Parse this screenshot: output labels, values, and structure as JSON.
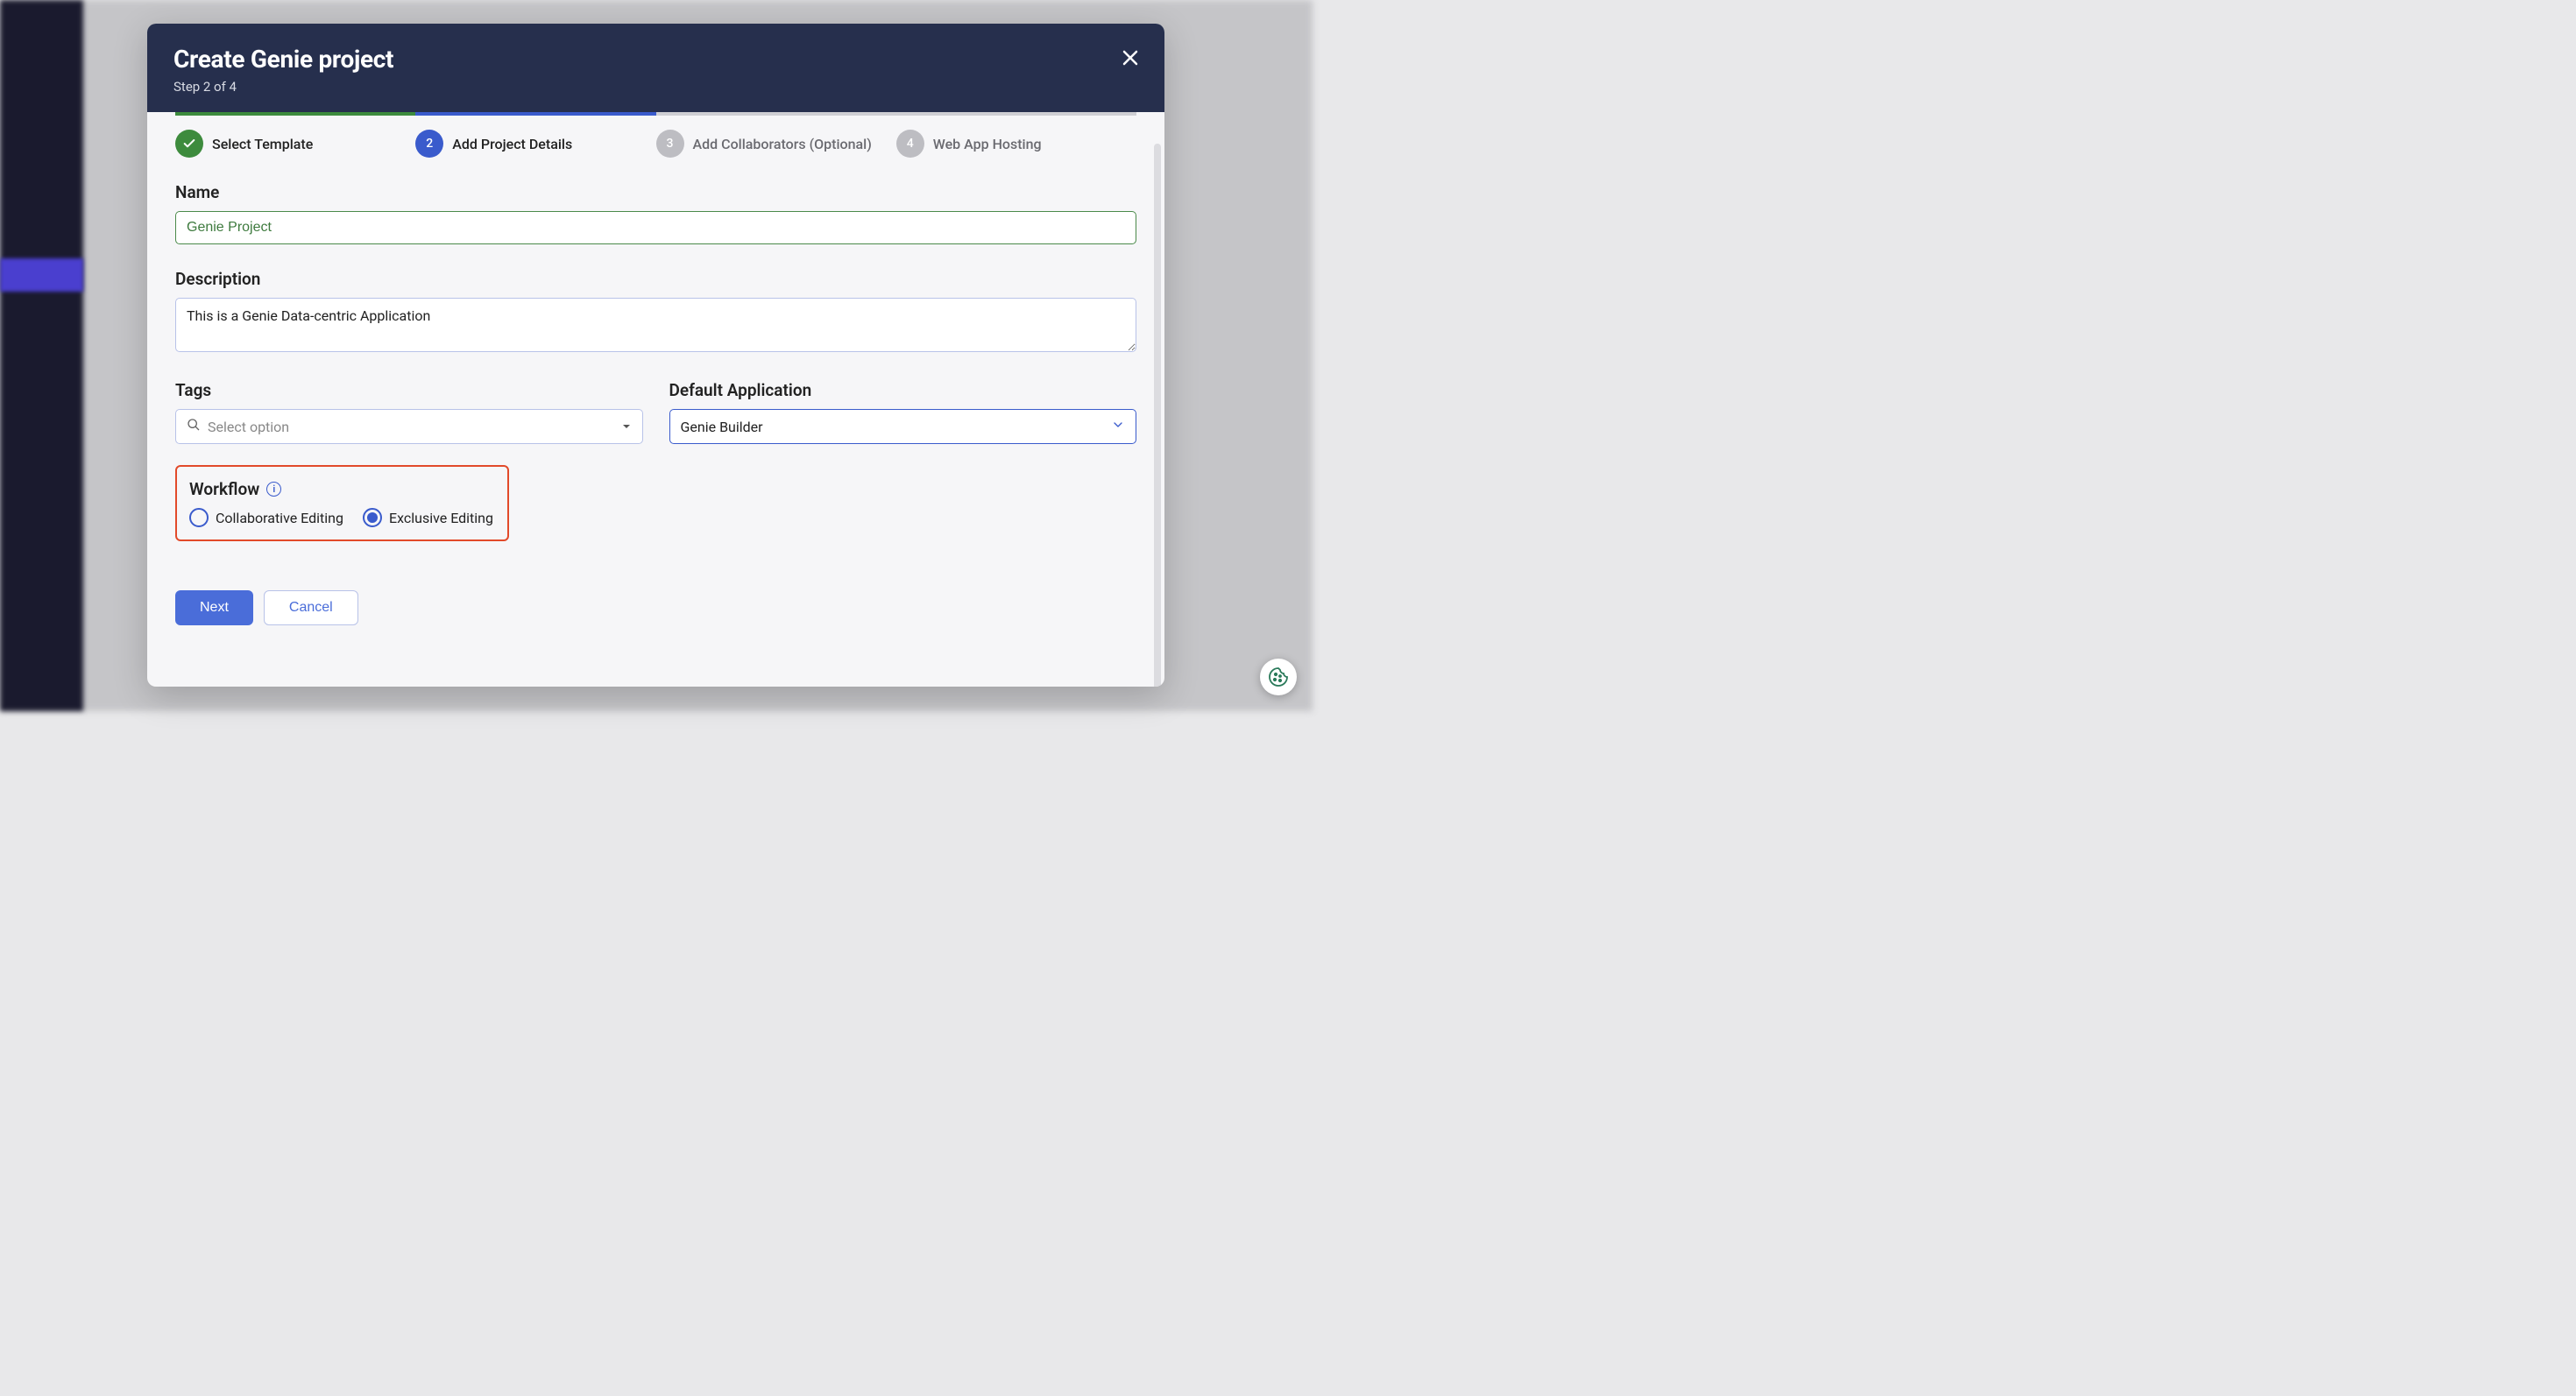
{
  "modal": {
    "title": "Create Genie project",
    "step_text": "Step 2 of 4"
  },
  "stepper": {
    "steps": [
      {
        "num": "✓",
        "label": "Select Template",
        "state": "completed"
      },
      {
        "num": "2",
        "label": "Add Project Details",
        "state": "active"
      },
      {
        "num": "3",
        "label": "Add Collaborators (Optional)",
        "state": "pending"
      },
      {
        "num": "4",
        "label": "Web App Hosting",
        "state": "pending"
      }
    ]
  },
  "form": {
    "name_label": "Name",
    "name_value": "Genie Project",
    "description_label": "Description",
    "description_value": "This is a Genie Data-centric Application",
    "tags_label": "Tags",
    "tags_placeholder": "Select option",
    "default_app_label": "Default Application",
    "default_app_value": "Genie Builder",
    "workflow_label": "Workflow",
    "workflow_options": {
      "collaborative": "Collaborative Editing",
      "exclusive": "Exclusive Editing"
    },
    "workflow_selected": "exclusive"
  },
  "buttons": {
    "next": "Next",
    "cancel": "Cancel"
  }
}
